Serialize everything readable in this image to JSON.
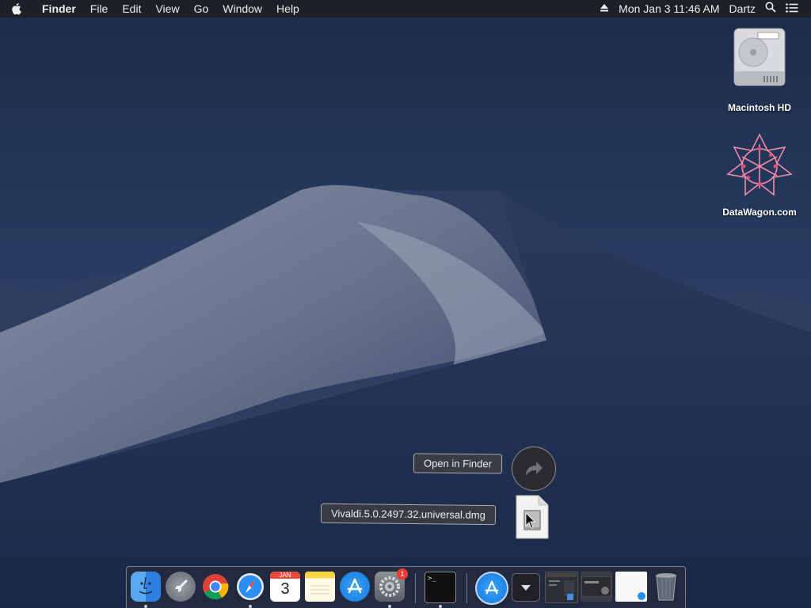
{
  "menubar": {
    "app_name": "Finder",
    "menus": [
      "File",
      "Edit",
      "View",
      "Go",
      "Window",
      "Help"
    ],
    "clock": "Mon Jan 3  11:46 AM",
    "user": "Dartz"
  },
  "desktop": {
    "icons": [
      {
        "label": "Macintosh HD",
        "icon": "hard-drive-icon"
      },
      {
        "label": "DataWagon.com",
        "icon": "datawagon-logo-icon"
      }
    ]
  },
  "drag_hud": {
    "action_label": "Open in Finder",
    "file_label": "Vivaldi.5.0.2497.32.universal.dmg"
  },
  "dock": {
    "items": [
      {
        "name": "Finder",
        "icon": "finder-icon",
        "running": true
      },
      {
        "name": "Launchpad",
        "icon": "launchpad-icon",
        "running": false
      },
      {
        "name": "Google Chrome",
        "icon": "chrome-icon",
        "running": false
      },
      {
        "name": "Safari",
        "icon": "safari-icon",
        "running": true
      },
      {
        "name": "Calendar",
        "icon": "calendar-icon",
        "running": false,
        "text": "3",
        "month": "JAN"
      },
      {
        "name": "Notes",
        "icon": "notes-icon",
        "running": false
      },
      {
        "name": "App Store",
        "icon": "app-store-icon",
        "running": false
      },
      {
        "name": "System Preferences",
        "icon": "system-preferences-icon",
        "running": true,
        "badge": "1"
      },
      {
        "name": "Terminal",
        "icon": "terminal-icon",
        "running": true
      },
      {
        "name": "Applications",
        "icon": "applications-folder-icon"
      },
      {
        "name": "Downloads",
        "icon": "downloads-stack-icon"
      },
      {
        "name": "Window 1",
        "icon": "minimized-window-icon"
      },
      {
        "name": "Window 2",
        "icon": "minimized-window-icon"
      },
      {
        "name": "Window 3",
        "icon": "minimized-window-icon"
      },
      {
        "name": "Trash",
        "icon": "trash-icon"
      }
    ]
  },
  "colors": {
    "menubar": "#1e2026",
    "sky": "#24375a",
    "accent_blue": "#1e88e5",
    "badge_red": "#f03b32"
  }
}
